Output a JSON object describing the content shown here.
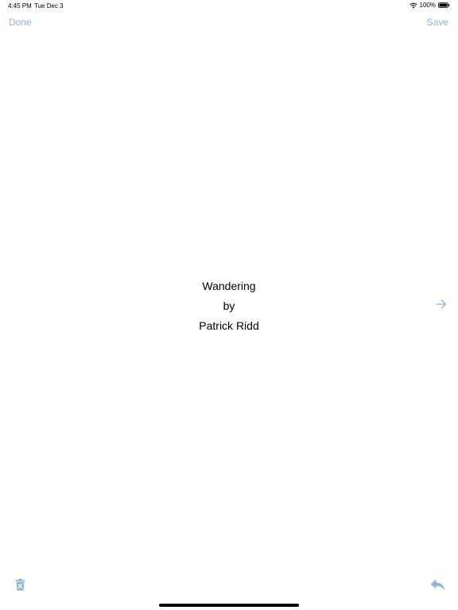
{
  "status_bar": {
    "time": "4:45 PM",
    "date": "Tue Dec 3",
    "battery": "100%"
  },
  "nav": {
    "done_label": "Done",
    "save_label": "Save"
  },
  "content": {
    "title": "Wandering",
    "by": "by",
    "author": "Patrick Ridd"
  },
  "icons": {
    "next": "arrow-right-icon",
    "trash": "trash-icon",
    "reply": "reply-icon",
    "wifi": "wifi-icon",
    "battery": "battery-icon"
  },
  "colors": {
    "accent": "#8fb5d8",
    "text": "#000000",
    "background": "#ffffff"
  }
}
